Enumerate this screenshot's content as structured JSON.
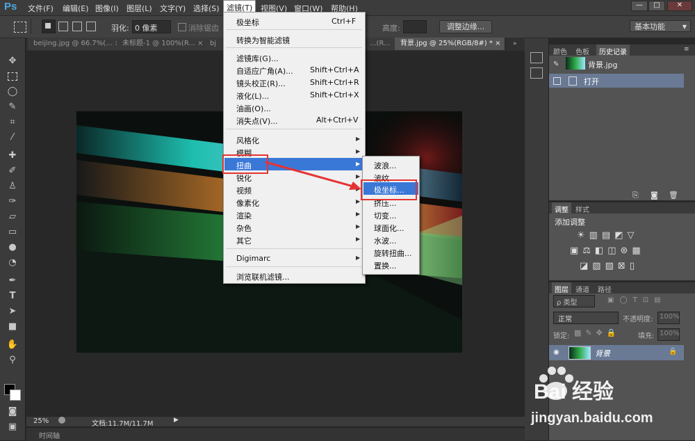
{
  "app": {
    "logo": "Ps"
  },
  "menubar": {
    "items": [
      "文件(F)",
      "编辑(E)",
      "图像(I)",
      "图层(L)",
      "文字(Y)",
      "选择(S)",
      "滤镜(T)",
      "视图(V)",
      "窗口(W)",
      "帮助(H)"
    ],
    "active": "滤镜(T)",
    "window_buttons": [
      "—",
      "□",
      "✕"
    ]
  },
  "options": {
    "feather_label": "羽化:",
    "feather_value": "0 像素",
    "antialias_label": "消除锯齿",
    "height_label": "高度:",
    "refine_edge_label": "调整边缘...",
    "workspace": "基本功能"
  },
  "tabs": [
    {
      "label": "beijing.jpg @ 66.7%(...",
      "close": "×"
    },
    {
      "label": "未标题-1 @ 100%(R...",
      "close": "×"
    },
    {
      "label": "bj",
      "close": ""
    },
    {
      "label": "...(R...",
      "close": ""
    },
    {
      "label": "背景.jpg @ 25%(RGB/8#) *",
      "close": "×"
    }
  ],
  "filter_menu": {
    "items": [
      {
        "label": "极坐标",
        "shortcut": "Ctrl+F"
      },
      {
        "label": "转换为智能滤镜",
        "shortcut": ""
      },
      {
        "label": "滤镜库(G)...",
        "shortcut": ""
      },
      {
        "label": "自适应广角(A)...",
        "shortcut": "Shift+Ctrl+A"
      },
      {
        "label": "镜头校正(R)...",
        "shortcut": "Shift+Ctrl+R"
      },
      {
        "label": "液化(L)...",
        "shortcut": "Shift+Ctrl+X"
      },
      {
        "label": "油画(O)...",
        "shortcut": ""
      },
      {
        "label": "消失点(V)...",
        "shortcut": "Alt+Ctrl+V"
      },
      {
        "label": "风格化",
        "shortcut": ""
      },
      {
        "label": "模糊",
        "shortcut": ""
      },
      {
        "label": "扭曲",
        "shortcut": ""
      },
      {
        "label": "锐化",
        "shortcut": ""
      },
      {
        "label": "视频",
        "shortcut": ""
      },
      {
        "label": "像素化",
        "shortcut": ""
      },
      {
        "label": "渲染",
        "shortcut": ""
      },
      {
        "label": "杂色",
        "shortcut": ""
      },
      {
        "label": "其它",
        "shortcut": ""
      },
      {
        "label": "Digimarc",
        "shortcut": ""
      },
      {
        "label": "浏览联机滤镜...",
        "shortcut": ""
      }
    ],
    "highlighted": "扭曲"
  },
  "distort_submenu": {
    "items": [
      "波浪...",
      "波纹...",
      "极坐标...",
      "挤压...",
      "切变...",
      "球面化...",
      "水波...",
      "旋转扭曲...",
      "置换..."
    ],
    "highlighted": "极坐标..."
  },
  "status": {
    "zoom": "25%",
    "doc": "文档:11.7M/11.7M",
    "timeline": "时间轴"
  },
  "history_panel": {
    "tabs": [
      "颜色",
      "色板",
      "历史记录"
    ],
    "active_tab": "历史记录",
    "snapshot": "背景.jpg",
    "steps": [
      "打开"
    ]
  },
  "adjust_panel": {
    "tabs": [
      "调整",
      "样式"
    ],
    "title": "添加调整"
  },
  "layers_panel": {
    "tabs": [
      "图层",
      "通道",
      "路径"
    ],
    "filter_label": "ρ 类型",
    "blend_mode": "正常",
    "opacity_label": "不透明度:",
    "opacity_value": "100%",
    "lock_label": "锁定:",
    "fill_label": "填充:",
    "fill_value": "100%",
    "layer_name": "背景"
  },
  "watermark": {
    "brand": "Bai 经验",
    "url": "jingyan.baidu.com"
  },
  "colors": {
    "accent": "#3a78d8",
    "annotation_red": "#e53333",
    "ui_dark": "#3c3c3c",
    "panel": "#535353"
  }
}
